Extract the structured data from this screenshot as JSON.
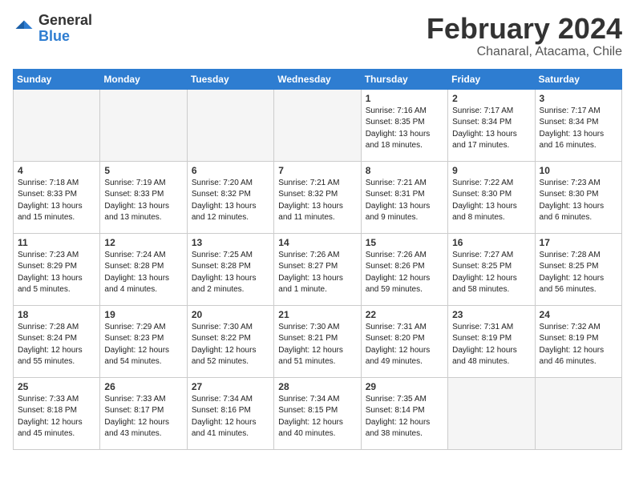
{
  "logo": {
    "general": "General",
    "blue": "Blue"
  },
  "title": "February 2024",
  "location": "Chanaral, Atacama, Chile",
  "days_of_week": [
    "Sunday",
    "Monday",
    "Tuesday",
    "Wednesday",
    "Thursday",
    "Friday",
    "Saturday"
  ],
  "weeks": [
    [
      {
        "day": "",
        "empty": true
      },
      {
        "day": "",
        "empty": true
      },
      {
        "day": "",
        "empty": true
      },
      {
        "day": "",
        "empty": true
      },
      {
        "day": "1",
        "sunrise": "7:16 AM",
        "sunset": "8:35 PM",
        "daylight": "13 hours and 18 minutes."
      },
      {
        "day": "2",
        "sunrise": "7:17 AM",
        "sunset": "8:34 PM",
        "daylight": "13 hours and 17 minutes."
      },
      {
        "day": "3",
        "sunrise": "7:17 AM",
        "sunset": "8:34 PM",
        "daylight": "13 hours and 16 minutes."
      }
    ],
    [
      {
        "day": "4",
        "sunrise": "7:18 AM",
        "sunset": "8:33 PM",
        "daylight": "13 hours and 15 minutes."
      },
      {
        "day": "5",
        "sunrise": "7:19 AM",
        "sunset": "8:33 PM",
        "daylight": "13 hours and 13 minutes."
      },
      {
        "day": "6",
        "sunrise": "7:20 AM",
        "sunset": "8:32 PM",
        "daylight": "13 hours and 12 minutes."
      },
      {
        "day": "7",
        "sunrise": "7:21 AM",
        "sunset": "8:32 PM",
        "daylight": "13 hours and 11 minutes."
      },
      {
        "day": "8",
        "sunrise": "7:21 AM",
        "sunset": "8:31 PM",
        "daylight": "13 hours and 9 minutes."
      },
      {
        "day": "9",
        "sunrise": "7:22 AM",
        "sunset": "8:30 PM",
        "daylight": "13 hours and 8 minutes."
      },
      {
        "day": "10",
        "sunrise": "7:23 AM",
        "sunset": "8:30 PM",
        "daylight": "13 hours and 6 minutes."
      }
    ],
    [
      {
        "day": "11",
        "sunrise": "7:23 AM",
        "sunset": "8:29 PM",
        "daylight": "13 hours and 5 minutes."
      },
      {
        "day": "12",
        "sunrise": "7:24 AM",
        "sunset": "8:28 PM",
        "daylight": "13 hours and 4 minutes."
      },
      {
        "day": "13",
        "sunrise": "7:25 AM",
        "sunset": "8:28 PM",
        "daylight": "13 hours and 2 minutes."
      },
      {
        "day": "14",
        "sunrise": "7:26 AM",
        "sunset": "8:27 PM",
        "daylight": "13 hours and 1 minute."
      },
      {
        "day": "15",
        "sunrise": "7:26 AM",
        "sunset": "8:26 PM",
        "daylight": "12 hours and 59 minutes."
      },
      {
        "day": "16",
        "sunrise": "7:27 AM",
        "sunset": "8:25 PM",
        "daylight": "12 hours and 58 minutes."
      },
      {
        "day": "17",
        "sunrise": "7:28 AM",
        "sunset": "8:25 PM",
        "daylight": "12 hours and 56 minutes."
      }
    ],
    [
      {
        "day": "18",
        "sunrise": "7:28 AM",
        "sunset": "8:24 PM",
        "daylight": "12 hours and 55 minutes."
      },
      {
        "day": "19",
        "sunrise": "7:29 AM",
        "sunset": "8:23 PM",
        "daylight": "12 hours and 54 minutes."
      },
      {
        "day": "20",
        "sunrise": "7:30 AM",
        "sunset": "8:22 PM",
        "daylight": "12 hours and 52 minutes."
      },
      {
        "day": "21",
        "sunrise": "7:30 AM",
        "sunset": "8:21 PM",
        "daylight": "12 hours and 51 minutes."
      },
      {
        "day": "22",
        "sunrise": "7:31 AM",
        "sunset": "8:20 PM",
        "daylight": "12 hours and 49 minutes."
      },
      {
        "day": "23",
        "sunrise": "7:31 AM",
        "sunset": "8:19 PM",
        "daylight": "12 hours and 48 minutes."
      },
      {
        "day": "24",
        "sunrise": "7:32 AM",
        "sunset": "8:19 PM",
        "daylight": "12 hours and 46 minutes."
      }
    ],
    [
      {
        "day": "25",
        "sunrise": "7:33 AM",
        "sunset": "8:18 PM",
        "daylight": "12 hours and 45 minutes."
      },
      {
        "day": "26",
        "sunrise": "7:33 AM",
        "sunset": "8:17 PM",
        "daylight": "12 hours and 43 minutes."
      },
      {
        "day": "27",
        "sunrise": "7:34 AM",
        "sunset": "8:16 PM",
        "daylight": "12 hours and 41 minutes."
      },
      {
        "day": "28",
        "sunrise": "7:34 AM",
        "sunset": "8:15 PM",
        "daylight": "12 hours and 40 minutes."
      },
      {
        "day": "29",
        "sunrise": "7:35 AM",
        "sunset": "8:14 PM",
        "daylight": "12 hours and 38 minutes."
      },
      {
        "day": "",
        "empty": true
      },
      {
        "day": "",
        "empty": true
      }
    ]
  ]
}
